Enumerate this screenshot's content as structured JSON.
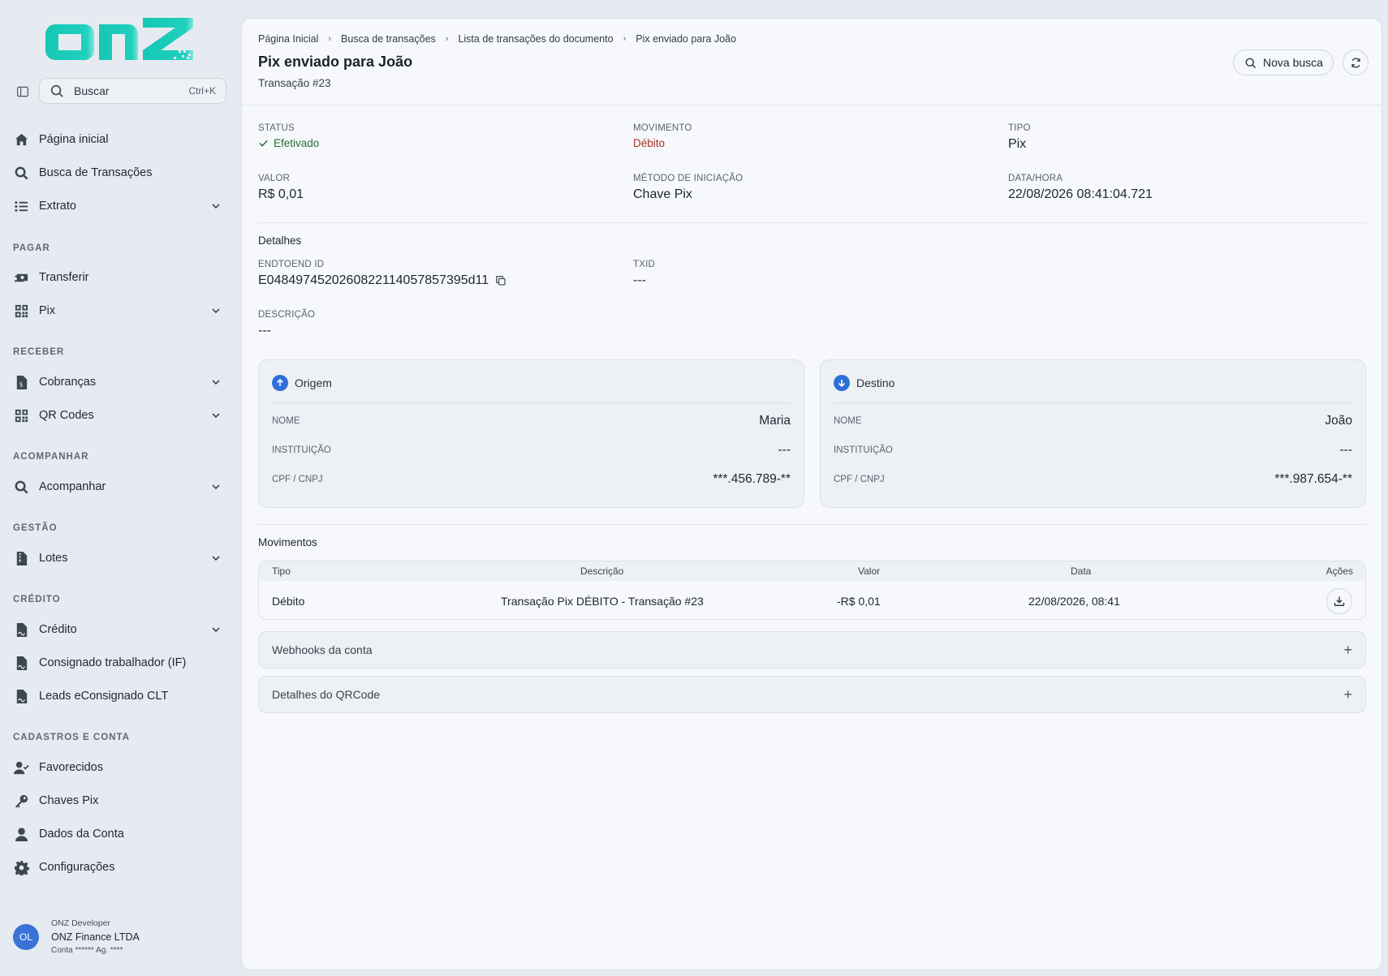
{
  "brand": {
    "logo_text": "onz",
    "accent": "#19c9b7"
  },
  "search": {
    "placeholder": "Buscar",
    "shortcut": "Ctrl+K"
  },
  "nav": {
    "main": [
      {
        "label": "Página inicial",
        "icon": "home-icon"
      },
      {
        "label": "Busca de Transações",
        "icon": "search-icon"
      },
      {
        "label": "Extrato",
        "icon": "list-icon"
      }
    ],
    "sections": {
      "pagar": "PAGAR",
      "receber": "RECEBER",
      "acompanhar": "ACOMPANHAR",
      "gestao": "GESTÃO",
      "credito": "CRÉDITO",
      "cadastros": "CADASTROS E CONTA"
    },
    "pagar": [
      {
        "label": "Transferir"
      },
      {
        "label": "Pix"
      }
    ],
    "receber": [
      {
        "label": "Cobranças"
      },
      {
        "label": "QR Codes"
      }
    ],
    "acompanhar": [
      {
        "label": "Acompanhar"
      }
    ],
    "gestao": [
      {
        "label": "Lotes"
      }
    ],
    "credito": [
      {
        "label": "Crédito"
      },
      {
        "label": "Consignado trabalhador (IF)"
      },
      {
        "label": "Leads eConsignado CLT"
      }
    ],
    "cadastros": [
      {
        "label": "Favorecidos"
      },
      {
        "label": "Chaves Pix"
      },
      {
        "label": "Dados da Conta"
      },
      {
        "label": "Configurações"
      }
    ]
  },
  "user": {
    "initials": "OL",
    "role": "ONZ Developer",
    "company": "ONZ Finance LTDA",
    "account": "Conta ****** Ag. ****"
  },
  "breadcrumb": [
    "Página Inicial",
    "Busca de transações",
    "Lista de transações do documento",
    "Pix enviado para João"
  ],
  "header": {
    "title": "Pix enviado para João",
    "subtitle": "Transação #23",
    "nova_busca": "Nova busca"
  },
  "summary": {
    "status_label": "STATUS",
    "status_value": "Efetivado",
    "movimento_label": "MOVIMENTO",
    "movimento_value": "Débito",
    "tipo_label": "TIPO",
    "tipo_value": "Pix",
    "valor_label": "VALOR",
    "valor_value": "R$ 0,01",
    "metodo_label": "MÉTODO DE INICIAÇÃO",
    "metodo_value": "Chave Pix",
    "data_label": "DATA/HORA",
    "data_value": "22/08/2026 08:41:04.721"
  },
  "details": {
    "title": "Detalhes",
    "endtoend_label": "ENDTOEND ID",
    "endtoend_value": "E04849745202608221140578573 95d11",
    "txid_label": "TXID",
    "txid_value": "---",
    "descricao_label": "DESCRIÇÃO",
    "descricao_value": "---"
  },
  "origem": {
    "title": "Origem",
    "nome_label": "NOME",
    "nome_value": "Maria",
    "inst_label": "INSTITUIÇÃO",
    "inst_value": "---",
    "doc_label": "CPF / CNPJ",
    "doc_value": "***.456.789-**"
  },
  "destino": {
    "title": "Destino",
    "nome_label": "NOME",
    "nome_value": "João",
    "inst_label": "INSTITUIÇÃO",
    "inst_value": "---",
    "doc_label": "CPF / CNPJ",
    "doc_value": "***.987.654-**"
  },
  "movimentos": {
    "title": "Movimentos",
    "columns": [
      "Tipo",
      "Descrição",
      "Valor",
      "Data",
      "Ações"
    ],
    "rows": [
      {
        "tipo": "Débito",
        "descricao": "Transação Pix DÉBITO - Transação #23",
        "valor": "-R$ 0,01",
        "data": "22/08/2026, 08:41"
      }
    ]
  },
  "accordions": {
    "webhooks": "Webhooks da conta",
    "qrcode": "Detalhes do QRCode"
  }
}
